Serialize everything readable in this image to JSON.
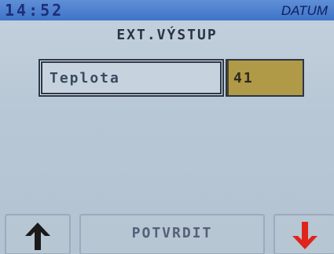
{
  "header": {
    "time": "14:52",
    "date_label": "DATUM"
  },
  "screen": {
    "title": "EXT.VÝSTUP"
  },
  "parameter": {
    "label": "Teplota",
    "value": "41"
  },
  "buttons": {
    "up_icon": "arrow-up-icon",
    "confirm_label": "POTVRDIT",
    "down_icon": "arrow-down-icon"
  },
  "colors": {
    "header_bg": "#4a7dd0",
    "screen_bg": "#b8c7d5",
    "value_bg": "#b09a47",
    "arrow_up": "#1a1a1a",
    "arrow_down": "#e0241b"
  }
}
